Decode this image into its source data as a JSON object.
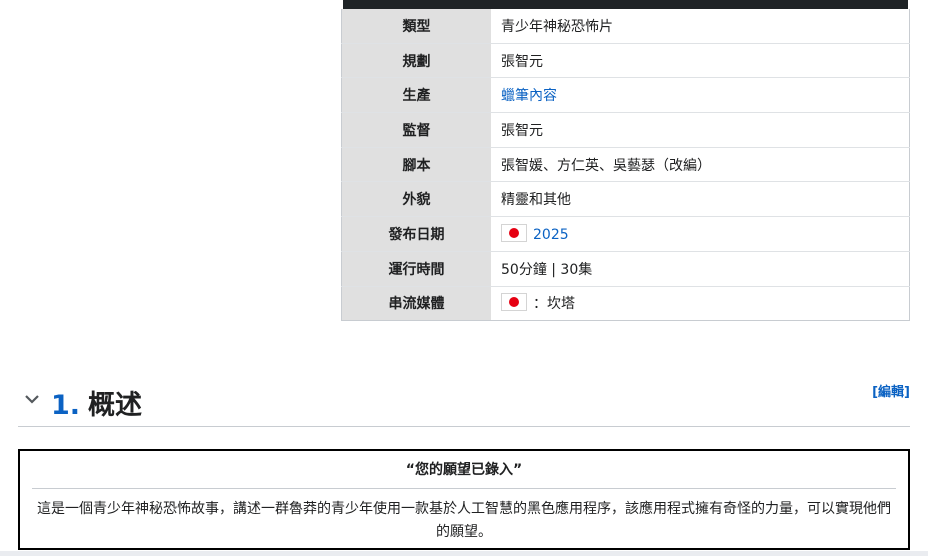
{
  "infobox": {
    "rows": [
      {
        "label": "類型",
        "value": "青少年神秘恐怖片"
      },
      {
        "label": "規劃",
        "value": "張智元"
      },
      {
        "label": "生產",
        "value": "蠟筆內容"
      },
      {
        "label": "監督",
        "value": "張智元"
      },
      {
        "label": "腳本",
        "value": "張智媛、方仁英、吳藝瑟（改編）"
      },
      {
        "label": "外貌",
        "value": "精靈和其他"
      },
      {
        "label": "發布日期",
        "value": "2025"
      },
      {
        "label": "運行時間",
        "value": "50分鐘 | 30集"
      },
      {
        "label": "串流媒體",
        "value": "：坎塔"
      }
    ]
  },
  "section": {
    "number": "1.",
    "title": "概述",
    "edit_label": "[編輯]"
  },
  "quote": {
    "title": "“您的願望已錄入”",
    "body": "這是一個青少年神秘恐怖故事，講述一群魯莽的青少年使用一款基於人工智慧的黑色應用程序，該應用程式擁有奇怪的力量，可以實現他們的願望。"
  },
  "icons": {
    "collapse": "chevron-down-icon",
    "flag": "japan-flag-icon"
  },
  "colors": {
    "link": "#0b62c3",
    "label_bg": "#e0e0e0",
    "flag_red": "#e60012"
  }
}
